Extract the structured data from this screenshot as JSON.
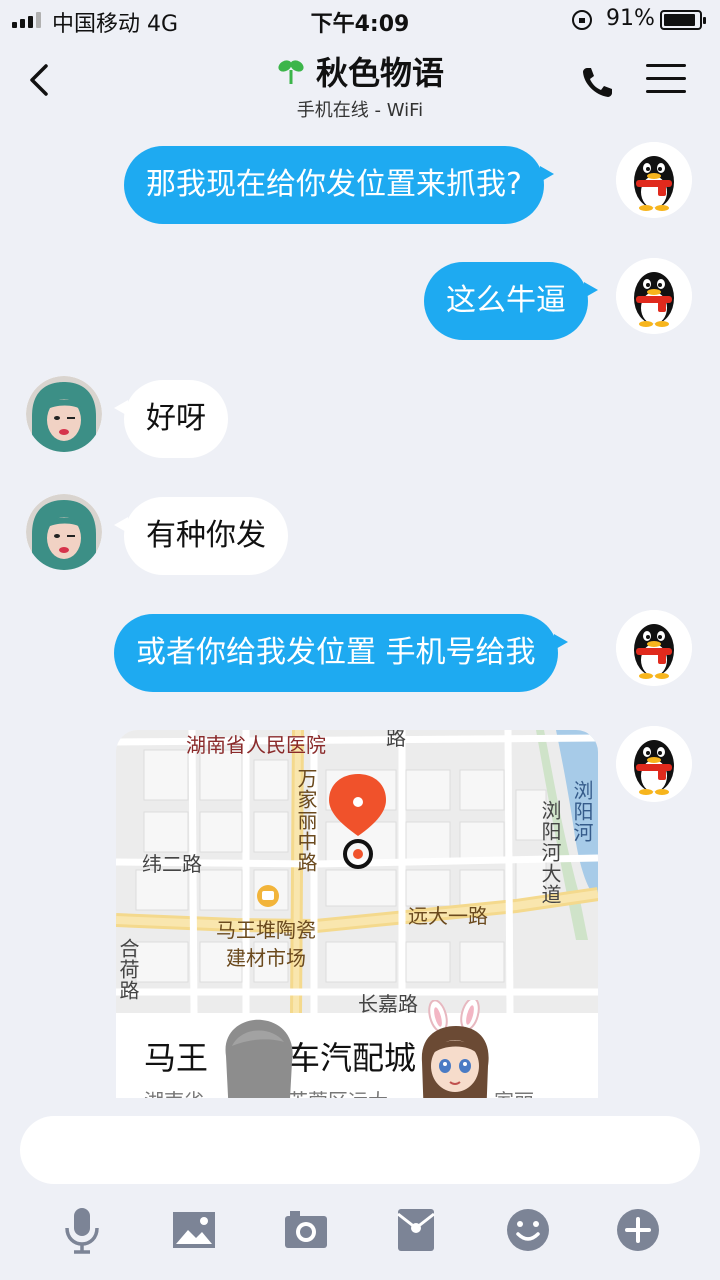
{
  "status_bar": {
    "carrier": "中国移动   4G",
    "time": "下午4:09",
    "battery_percent": "91%",
    "battery_level": 0.91
  },
  "header": {
    "title": "秋色物语",
    "subtitle": "手机在线 - WiFi",
    "icons": [
      "back-icon",
      "sprout-icon",
      "phone-icon",
      "menu-icon"
    ]
  },
  "messages": [
    {
      "direction": "sent",
      "text": "那我现在给你发位置来抓我?"
    },
    {
      "direction": "sent",
      "text": "这么牛逼"
    },
    {
      "direction": "received",
      "text": "好呀"
    },
    {
      "direction": "received",
      "text": "有种你发"
    },
    {
      "direction": "sent",
      "text": "或者你给我发位置 手机号给我"
    }
  ],
  "location_card": {
    "place_name": "马王堆汽车汽配城",
    "place_name_visible_left": "马王",
    "place_name_visible_right": "车汽配城",
    "address_visible_left": "湖南省",
    "address_visible_mid": "芙蓉区远大一",
    "address_visible_right": "家丽",
    "map_labels": {
      "hospital": "湖南省人民医院",
      "road_top": "路",
      "wanjiali": "万家丽中路",
      "weier": "纬二路",
      "market_line1": "马王堆陶瓷",
      "market_line2": "建材市场",
      "yuanda": "远大一路",
      "liuyang_river": "浏阳河大道",
      "liuyang_water": "浏阳河",
      "changjia": "长嘉路",
      "left_road": "合荷路"
    }
  },
  "input": {
    "placeholder": ""
  },
  "toolbar": [
    "microphone-icon",
    "image-icon",
    "camera-icon",
    "red-packet-icon",
    "emoji-icon",
    "plus-icon"
  ],
  "colors": {
    "sent_bubble": "#1eaaf1",
    "received_bubble": "#ffffff",
    "background": "#eef0f6",
    "map_pin": "#f0522b",
    "toolbar_icon": "#7c8496"
  }
}
